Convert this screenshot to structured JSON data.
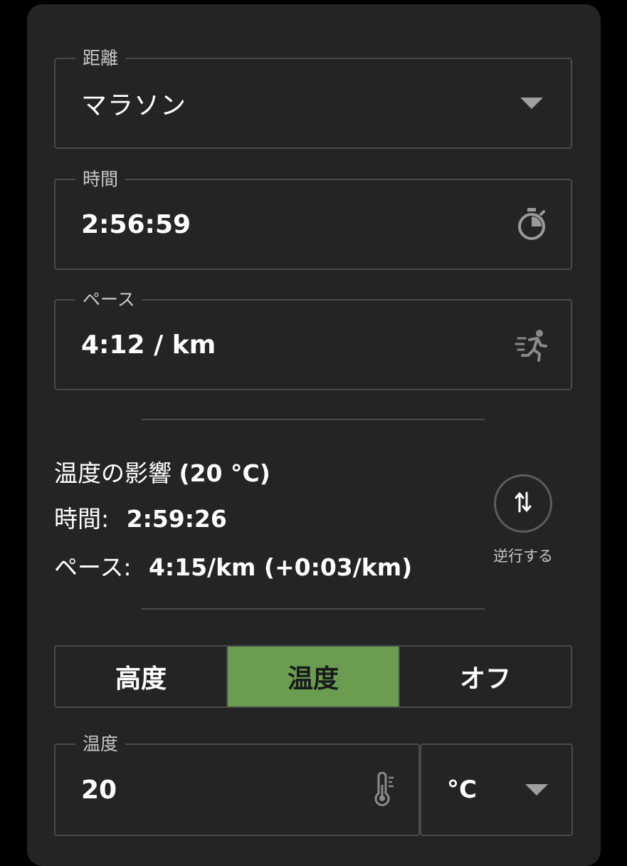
{
  "distance": {
    "label": "距離",
    "value": "マラソン",
    "icon": "chevron-down-icon"
  },
  "time": {
    "label": "時間",
    "value": "2:56:59",
    "icon": "stopwatch-icon"
  },
  "pace": {
    "label": "ペース",
    "value": "4:12 / km",
    "icon": "runner-icon"
  },
  "impact": {
    "title": "温度の影響",
    "title_value": "(20 °C)",
    "time_label": "時間:",
    "time_value": "2:59:26",
    "pace_label": "ペース:",
    "pace_value": "4:15/km (+0:03/km)"
  },
  "reverse": {
    "label": "逆行する",
    "icon": "swap-vertical-icon"
  },
  "mode_tabs": [
    {
      "label": "高度",
      "active": false
    },
    {
      "label": "温度",
      "active": true
    },
    {
      "label": "オフ",
      "active": false
    }
  ],
  "temperature": {
    "label": "温度",
    "value": "20",
    "icon": "thermometer-icon"
  },
  "unit": {
    "value": "°C",
    "icon": "chevron-down-icon"
  },
  "colors": {
    "accent": "#6a9d50",
    "panel": "#242424",
    "border": "#4a4a4a"
  }
}
